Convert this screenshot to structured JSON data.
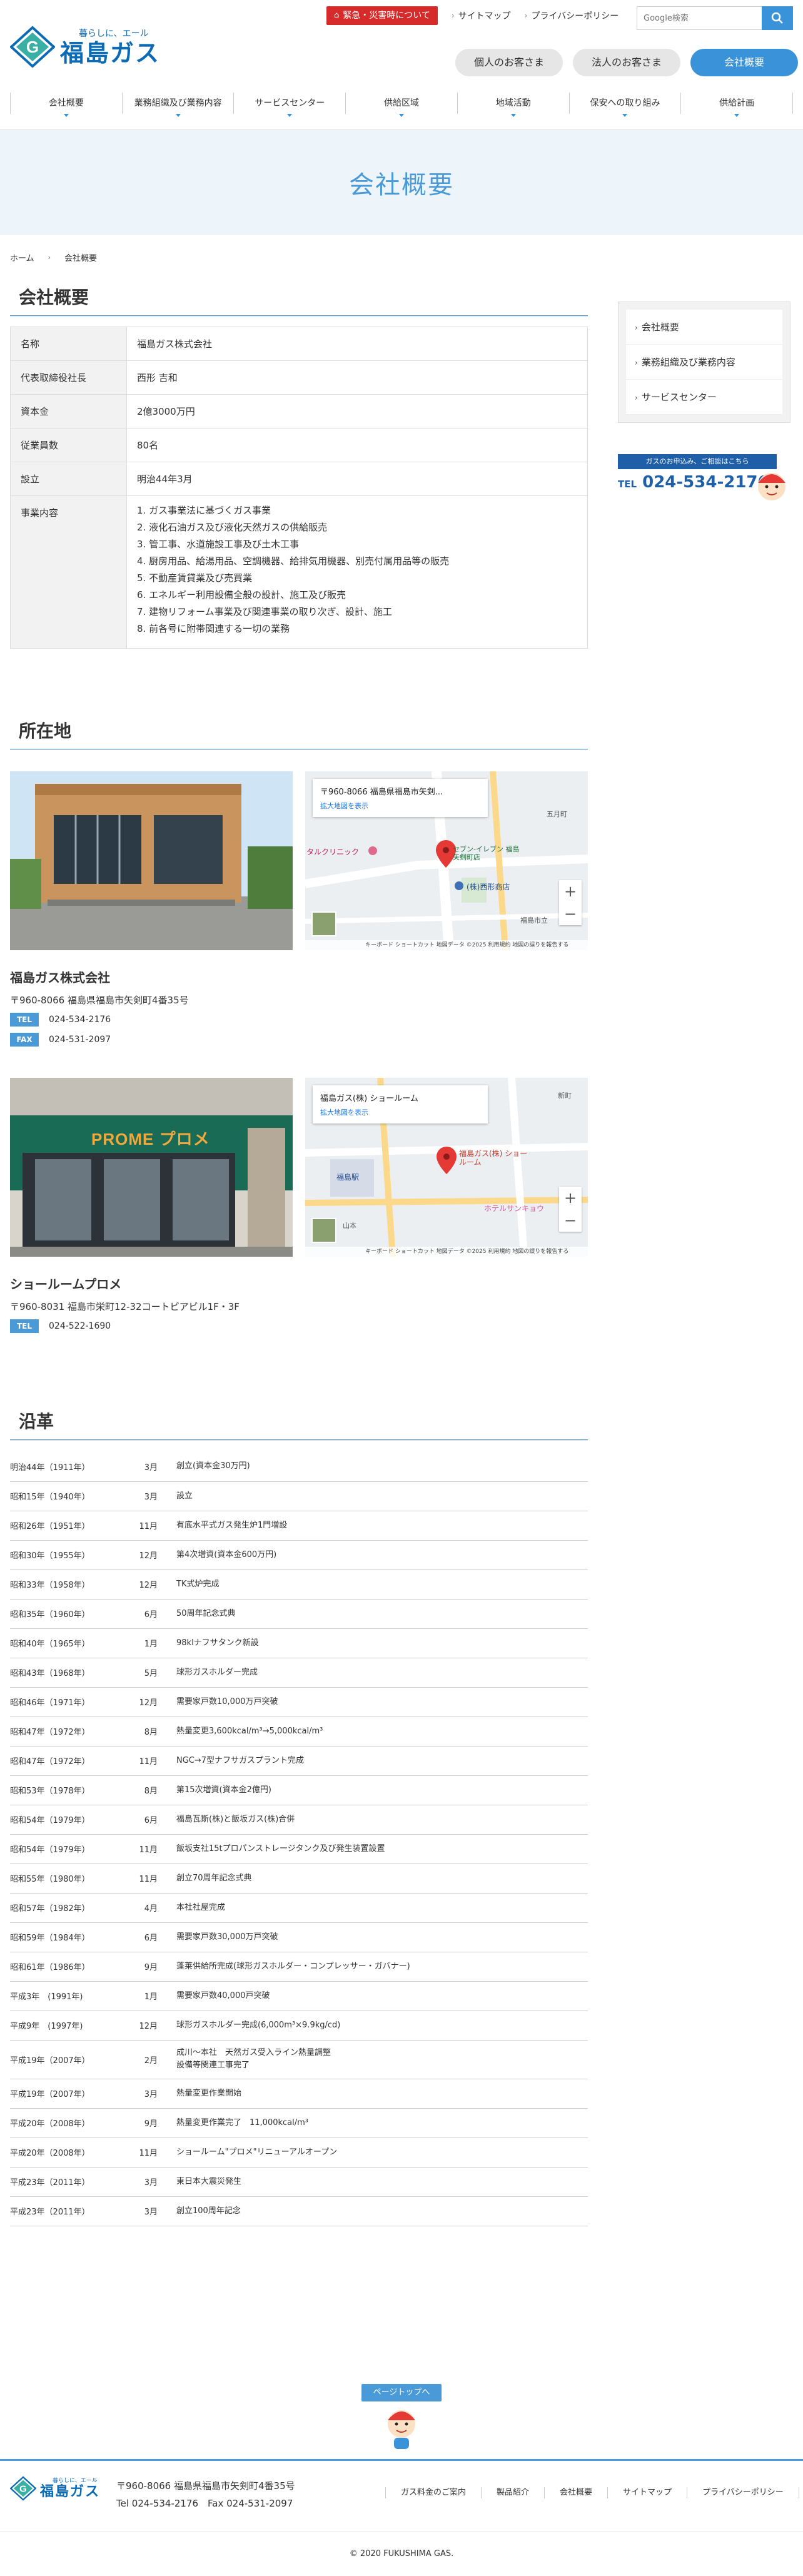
{
  "header": {
    "logo_tagline": "暮らしに、エール",
    "logo_name": "福島ガス",
    "logo_mark": "G",
    "emergency_label": "緊急・災害時について",
    "top_links": [
      "サイトマップ",
      "プライバシーポリシー"
    ],
    "search_placeholder": "Google検索",
    "user_tabs": [
      "個人のお客さま",
      "法人のお客さま",
      "会社概要"
    ],
    "nav": [
      "会社概要",
      "業務組織及び業務内容",
      "サービスセンター",
      "供給区域",
      "地域活動",
      "保安への取り組み",
      "供給計画"
    ],
    "accent_color": "#3a93d8",
    "emergency_color": "#d62b2b"
  },
  "hero": {
    "title": "会社概要"
  },
  "breadcrumb": [
    "ホーム",
    "会社概要"
  ],
  "overview": {
    "title": "会社概要",
    "rows": [
      {
        "label": "名称",
        "value": "福島ガス株式会社"
      },
      {
        "label": "代表取締役社長",
        "value": "西形 吉和"
      },
      {
        "label": "資本金",
        "value": "2億3000万円"
      },
      {
        "label": "従業員数",
        "value": "80名"
      },
      {
        "label": "設立",
        "value": "明治44年3月"
      }
    ],
    "business_label": "事業内容",
    "business": [
      "1. ガス事業法に基づくガス事業",
      "2. 液化石油ガス及び液化天然ガスの供給販売",
      "3. 管工事、水道施設工事及び土木工事",
      "4. 厨房用品、給湯用品、空調機器、給排気用機器、別売付属用品等の販売",
      "5. 不動産賃貸業及び売買業",
      "6. エネルギー利用設備全般の設計、施工及び販売",
      "7. 建物リフォーム事業及び関連事業の取り次ぎ、設計、施工",
      "8. 前各号に附帯関連する一切の業務"
    ]
  },
  "locations": {
    "title": "所在地",
    "items": [
      {
        "name": "福島ガス株式会社",
        "address": "〒960-8066 福島県福島市矢剣町4番35号",
        "tel_label": "TEL",
        "tel": "024-534-2176",
        "fax_label": "FAX",
        "fax": "024-531-2097",
        "map_title": "〒960-8066 福島県福島市矢剣...",
        "map_link": "拡大地図を表示",
        "map_labels": [
          "タルクリニック",
          "セブン-イレブン 福島矢剣町店",
          "(株)西形商店",
          "五月町",
          "福島市立"
        ],
        "map_footer": "キーボード ショートカット 地図データ ©2025 利用規約 地図の誤りを報告する",
        "photo_sign": ""
      },
      {
        "name": "ショールームプロメ",
        "address": "〒960-8031 福島市栄町12-32コートピアビル1F・3F",
        "tel_label": "TEL",
        "tel": "024-522-1690",
        "map_title": "福島ガス(株) ショールーム",
        "map_link": "拡大地図を表示",
        "map_labels": [
          "福島ガス(株) ショールーム",
          "福島駅",
          "新町",
          "ホテルサンキョウ",
          "山本"
        ],
        "map_footer": "キーボード ショートカット 地図データ ©2025 利用規約 地図の誤りを報告する",
        "photo_sign": "PROME プロメ"
      }
    ]
  },
  "history": {
    "title": "沿革",
    "rows": [
      {
        "year": "明治44年（1911年）",
        "month": "3月",
        "event": "創立(資本金30万円)"
      },
      {
        "year": "昭和15年（1940年）",
        "month": "3月",
        "event": "設立"
      },
      {
        "year": "昭和26年（1951年）",
        "month": "11月",
        "event": "有底水平式ガス発生炉1門増設"
      },
      {
        "year": "昭和30年（1955年）",
        "month": "12月",
        "event": "第4次増資(資本金600万円)"
      },
      {
        "year": "昭和33年（1958年）",
        "month": "12月",
        "event": "TK式炉完成"
      },
      {
        "year": "昭和35年（1960年）",
        "month": "6月",
        "event": "50周年記念式典"
      },
      {
        "year": "昭和40年（1965年）",
        "month": "1月",
        "event": "98klナフサタンク新設"
      },
      {
        "year": "昭和43年（1968年）",
        "month": "5月",
        "event": "球形ガスホルダー完成"
      },
      {
        "year": "昭和46年（1971年）",
        "month": "12月",
        "event": "需要家戸数10,000万戸突破"
      },
      {
        "year": "昭和47年（1972年）",
        "month": "8月",
        "event": "熱量変更3,600kcal/m³→5,000kcal/m³"
      },
      {
        "year": "昭和47年（1972年）",
        "month": "11月",
        "event": "NGC→7型ナフサガスプラント完成"
      },
      {
        "year": "昭和53年（1978年）",
        "month": "8月",
        "event": "第15次増資(資本金2億円)"
      },
      {
        "year": "昭和54年（1979年）",
        "month": "6月",
        "event": "福島瓦斯(株)と飯坂ガス(株)合併"
      },
      {
        "year": "昭和54年（1979年）",
        "month": "11月",
        "event": "飯坂支社15tプロパンストレージタンク及び発生装置設置"
      },
      {
        "year": "昭和55年（1980年）",
        "month": "11月",
        "event": "創立70周年記念式典"
      },
      {
        "year": "昭和57年（1982年）",
        "month": "4月",
        "event": "本社社屋完成"
      },
      {
        "year": "昭和59年（1984年）",
        "month": "6月",
        "event": "需要家戸数30,000万戸突破"
      },
      {
        "year": "昭和61年（1986年）",
        "month": "9月",
        "event": "蓬莱供給所完成(球形ガスホルダー・コンプレッサー・ガバナー)"
      },
      {
        "year": "平成3年　(1991年)",
        "month": "1月",
        "event": "需要家戸数40,000戸突破"
      },
      {
        "year": "平成9年　(1997年)",
        "month": "12月",
        "event": "球形ガスホルダー完成(6,000m³×9.9kg/cd)"
      },
      {
        "year": "平成19年（2007年）",
        "month": "2月",
        "event": "成川～本社　天然ガス受入ライン熱量調整\n設備等関連工事完了"
      },
      {
        "year": "平成19年（2007年）",
        "month": "3月",
        "event": "熱量変更作業開始"
      },
      {
        "year": "平成20年（2008年）",
        "month": "9月",
        "event": "熱量変更作業完了　11,000kcal/m³"
      },
      {
        "year": "平成20年（2008年）",
        "month": "11月",
        "event": "ショールーム\"プロメ\"リニューアルオープン"
      },
      {
        "year": "平成23年（2011年）",
        "month": "3月",
        "event": "東日本大震災発生"
      },
      {
        "year": "平成23年（2011年）",
        "month": "3月",
        "event": "創立100周年記念"
      }
    ]
  },
  "sidebar": {
    "menu": [
      "会社概要",
      "業務組織及び業務内容",
      "サービスセンター"
    ],
    "contact_head": "ガスのお申込み、ご相談はこちら",
    "tel_prefix": "TEL",
    "tel": "024-534-2176"
  },
  "pagetop": {
    "label": "ページトップへ"
  },
  "footer": {
    "address": "〒960-8066 福島県福島市矢剣町4番35号",
    "tel": "Tel 024-534-2176　Fax 024-531-2097",
    "links": [
      "ガス料金のご案内",
      "製品紹介",
      "会社概要",
      "サイトマップ",
      "プライバシーポリシー"
    ],
    "copyright": "© 2020 FUKUSHIMA GAS."
  }
}
